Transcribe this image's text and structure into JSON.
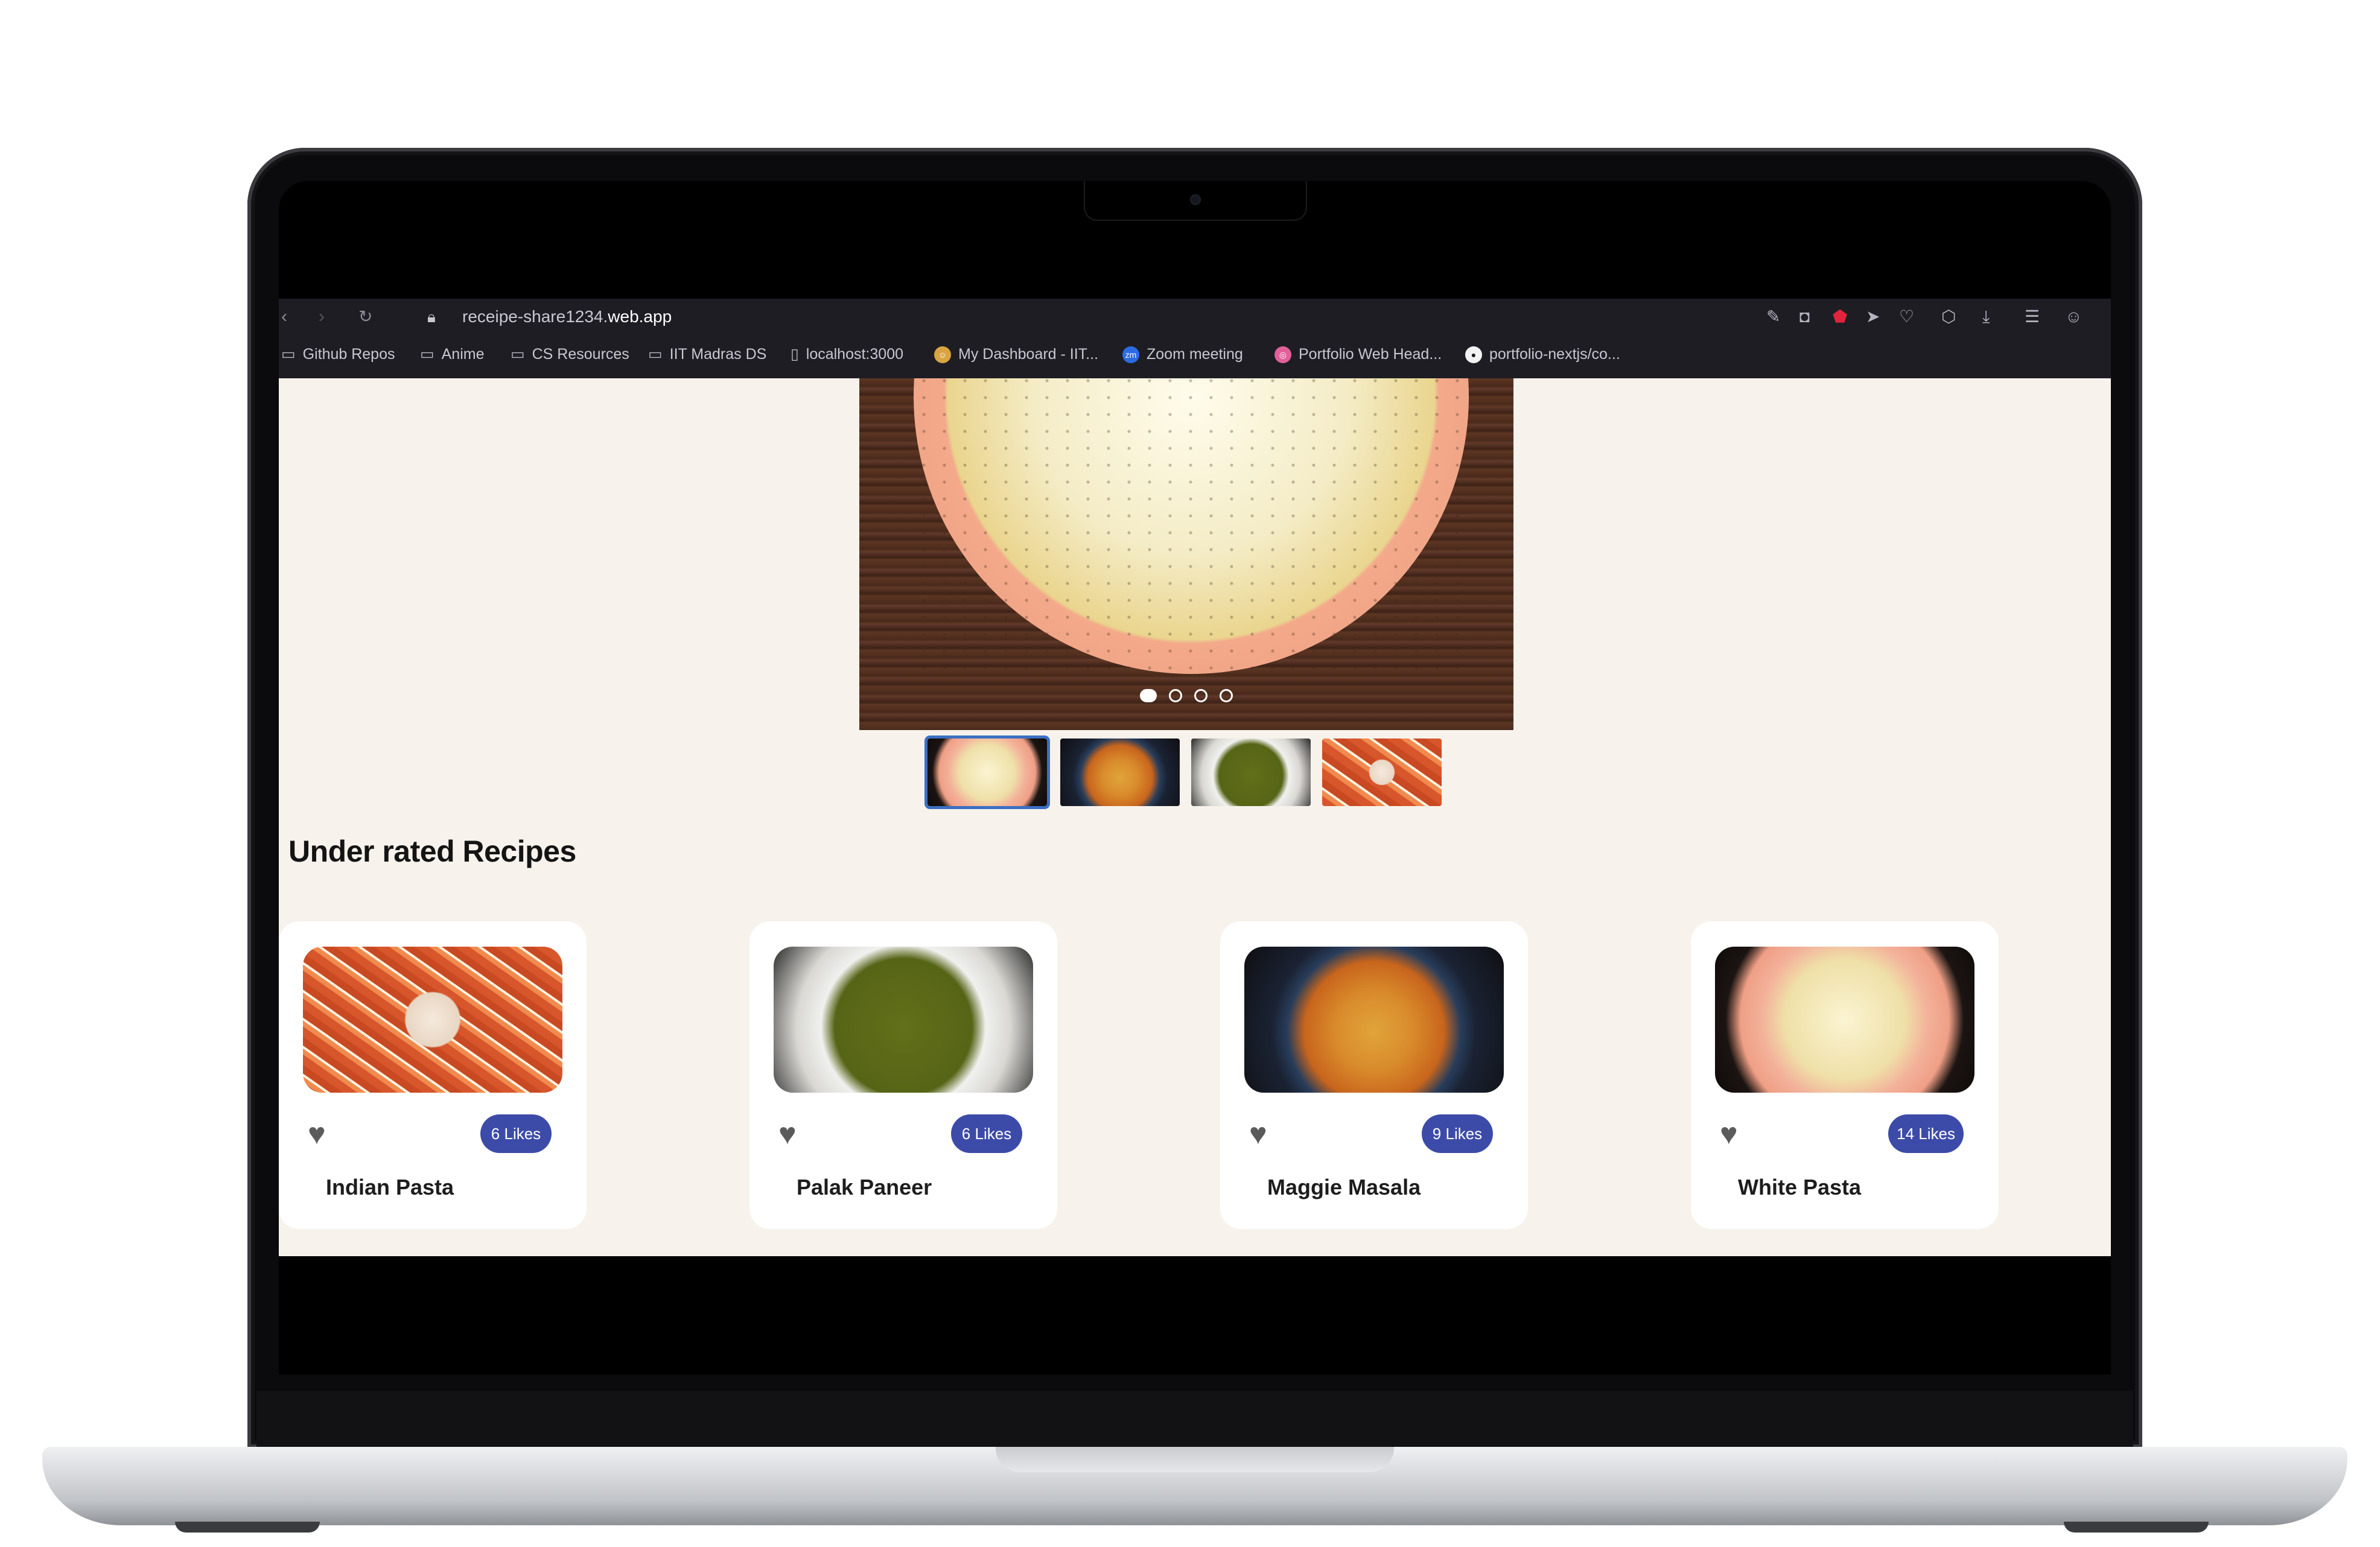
{
  "browser": {
    "url_prefix": "receipe-share1234.",
    "url_domain": "web.app",
    "bookmarks": [
      {
        "label": "Github Repos",
        "icon": "folder-icon"
      },
      {
        "label": "Anime",
        "icon": "folder-icon"
      },
      {
        "label": "CS Resources",
        "icon": "folder-icon"
      },
      {
        "label": "IIT Madras DS",
        "icon": "folder-icon"
      },
      {
        "label": "localhost:3000",
        "icon": "file-icon"
      },
      {
        "label": "My Dashboard - IIT...",
        "icon": "dashboard-icon"
      },
      {
        "label": "Zoom meeting",
        "icon": "zoom-icon"
      },
      {
        "label": "Portfolio Web Head...",
        "icon": "dribbble-icon"
      },
      {
        "label": "portfolio-nextjs/co...",
        "icon": "github-icon"
      }
    ]
  },
  "carousel": {
    "slide_count": 4,
    "active_index": 0
  },
  "section": {
    "title": "Under rated Recipes"
  },
  "recipes": [
    {
      "name": "Indian Pasta",
      "likes": "6 Likes"
    },
    {
      "name": "Palak Paneer",
      "likes": "6 Likes"
    },
    {
      "name": "Maggie Masala",
      "likes": "9 Likes"
    },
    {
      "name": "White Pasta",
      "likes": "14 Likes"
    }
  ],
  "colors": {
    "likes_badge": "#3d4ba8",
    "page_background": "#f7f2ec",
    "browser_chrome": "#1e1d24"
  }
}
